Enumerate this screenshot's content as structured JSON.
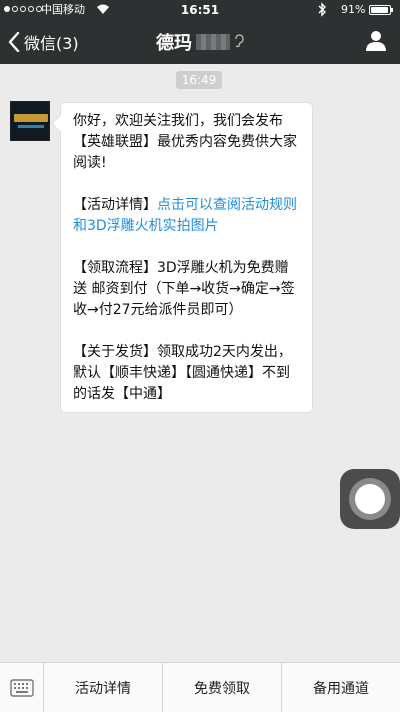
{
  "status_bar": {
    "carrier": "中国移动",
    "time": "16:51",
    "battery": "91%",
    "battery_level": 0.91
  },
  "nav": {
    "back_label": "微信(3)",
    "title": "德玛"
  },
  "chat": {
    "timestamp": "16:49",
    "message": {
      "p1": "你好，欢迎关注我们，我们会发布【英雄联盟】最优秀内容免费供大家阅读!",
      "p2_prefix": "【活动详情】",
      "p2_link": "点击可以查阅活动规则和3D浮雕火机实拍图片",
      "p3": "【领取流程】3D浮雕火机为免费赠送 邮资到付（下单→收货→确定→签收→付27元给派件员即可）",
      "p4": "【关于发货】领取成功2天内发出，默认【顺丰快递】【圆通快递】不到的话发【中通】"
    }
  },
  "menu": {
    "items": [
      "活动详情",
      "免费领取",
      "备用通道"
    ]
  },
  "colors": {
    "nav_bg": "#2e3132",
    "chat_bg": "#ebebeb",
    "link": "#1e8fe1"
  },
  "icons": [
    "back-chevron-icon",
    "wifi-icon",
    "bluetooth-icon",
    "ear-icon",
    "profile-icon",
    "keyboard-icon"
  ]
}
